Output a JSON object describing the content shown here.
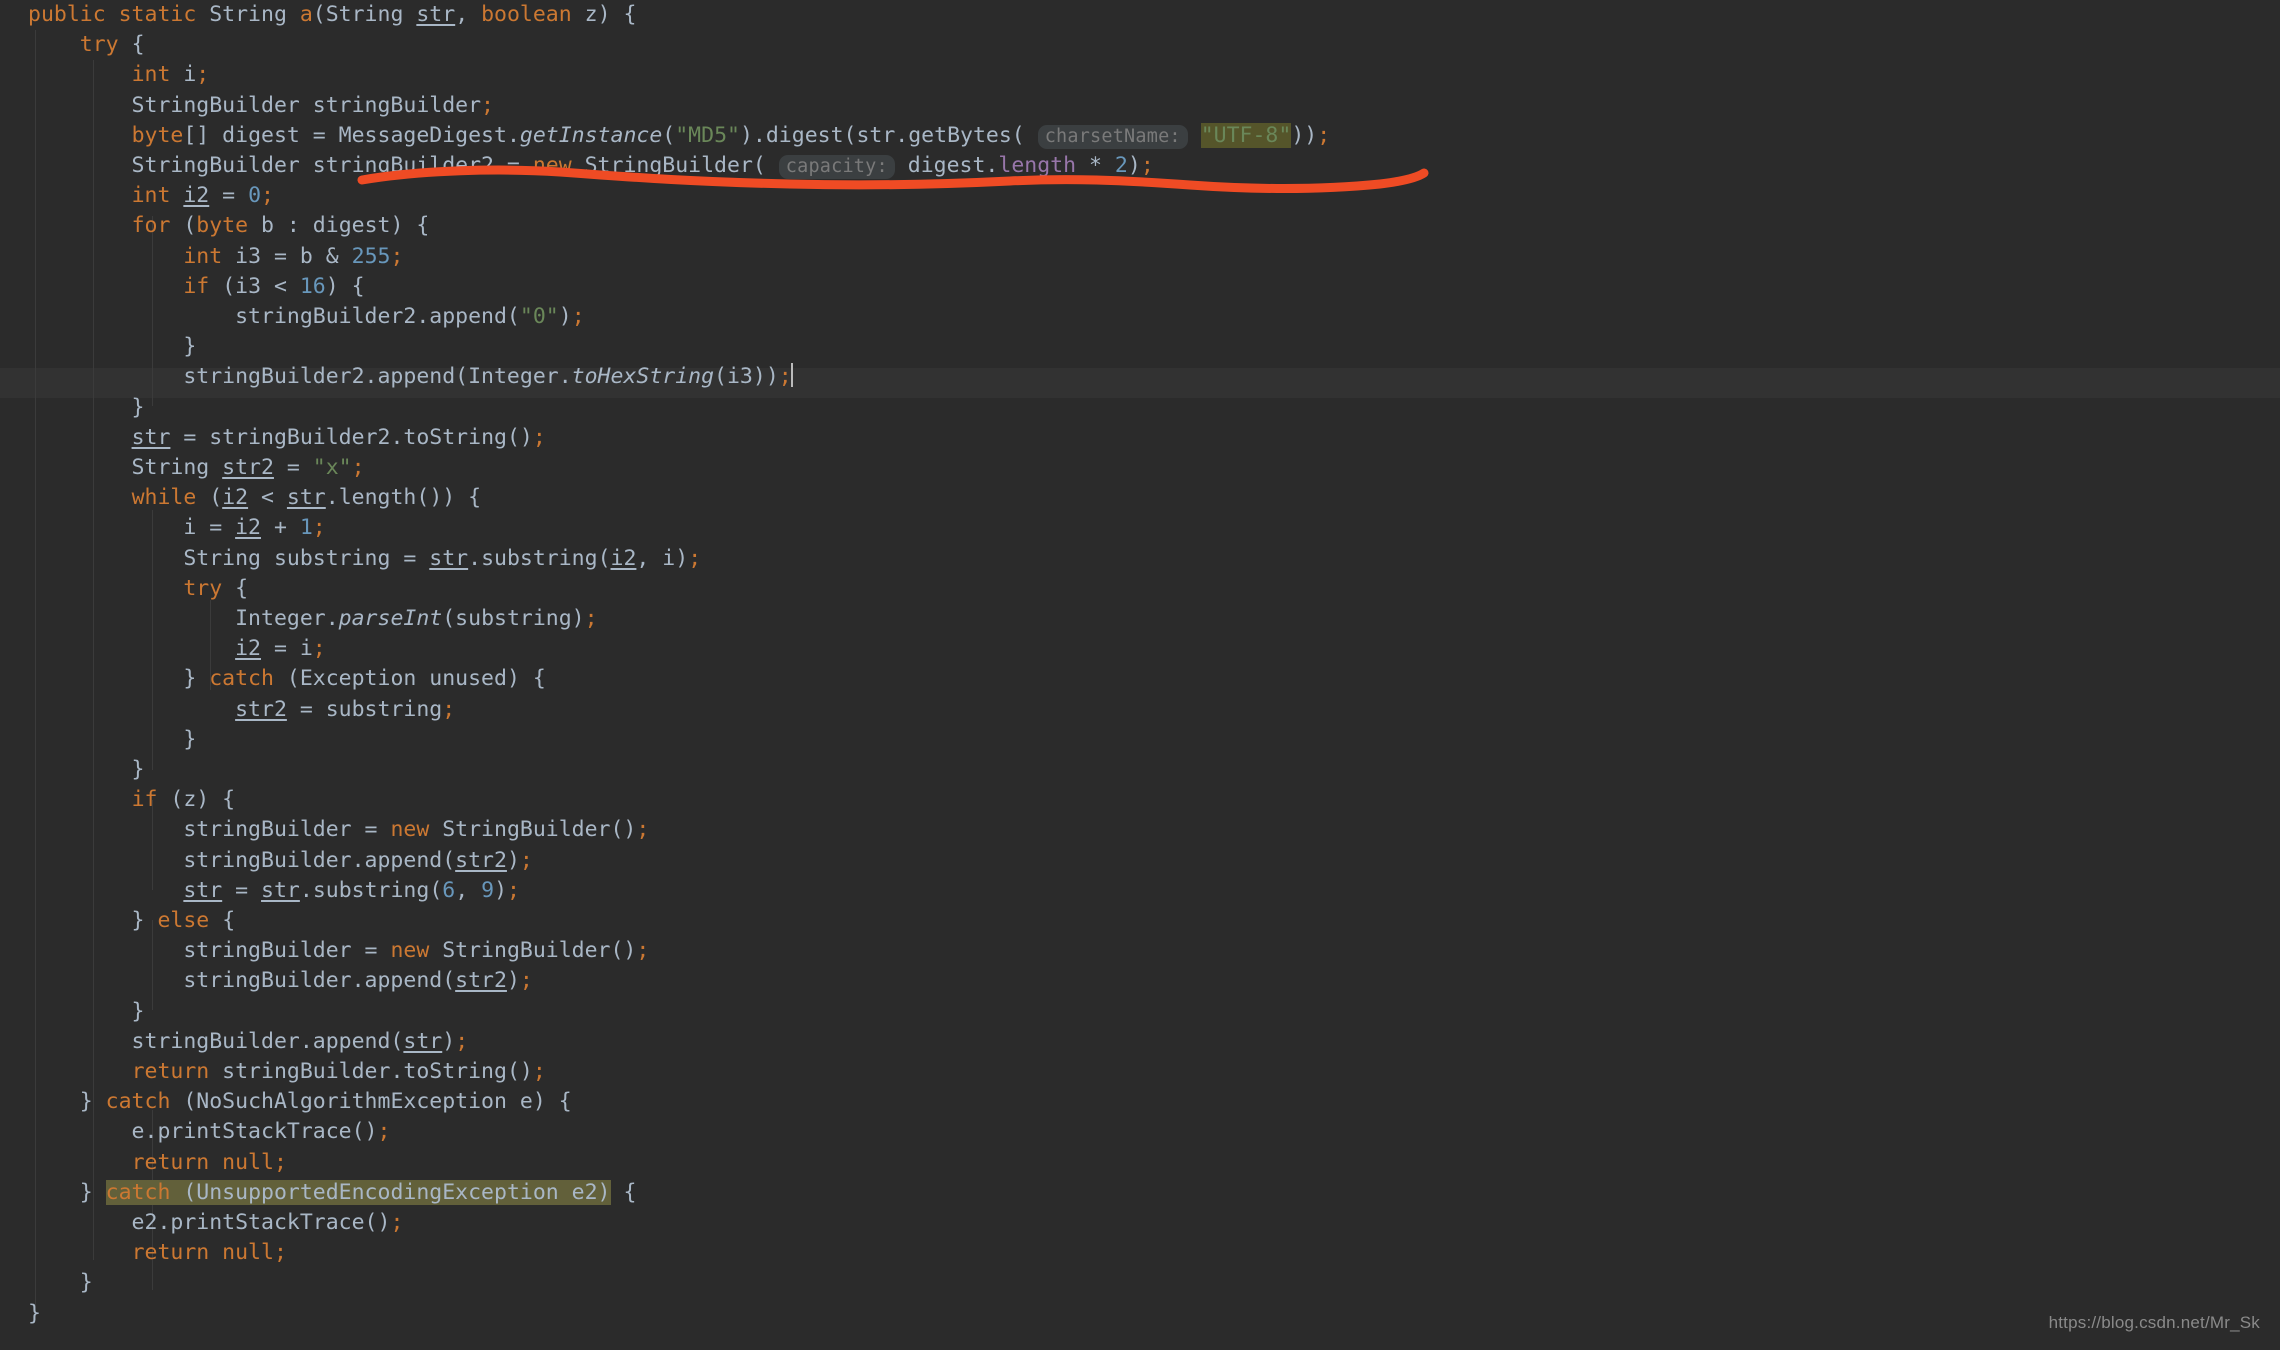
{
  "editor": {
    "language": "Java",
    "theme": "Darcula",
    "background_color": "#2b2b2b",
    "current_line_background": "#323232",
    "foreground_color": "#a9b7c6",
    "keyword_color": "#cc7832",
    "string_color": "#6a8759",
    "number_color": "#6897bb",
    "field_color": "#9876aa",
    "inlay_hint_color": "#7a7a7a",
    "usage_highlight_color": "#55552a",
    "font_size_px": 21.5,
    "line_height_px": 30.2,
    "current_line_number": 12,
    "caret_line_text": "stringBuilder2.append(Integer.toHexString(i3));"
  },
  "annotation": {
    "type": "freehand-stroke",
    "color": "#ef4b24",
    "target_line": "StringBuilder stringBuilder2 = new StringBuilder( capacity: digest.length * 2);"
  },
  "watermark": {
    "text": "https://blog.csdn.net/Mr_Sk"
  },
  "inlay_hints": [
    {
      "label": "charsetName:"
    },
    {
      "label": "capacity:"
    }
  ],
  "highlighted_tokens": [
    {
      "text": "\"UTF-8\"",
      "background": "#55552a"
    },
    {
      "text": "catch (UnsupportedEncodingException e2)",
      "background": "#62603a"
    }
  ],
  "code": {
    "lines": [
      "public static String a(String str, boolean z) {",
      "    try {",
      "        int i;",
      "        StringBuilder stringBuilder;",
      "        byte[] digest = MessageDigest.getInstance(\"MD5\").digest(str.getBytes( charsetName: \"UTF-8\"));",
      "        StringBuilder stringBuilder2 = new StringBuilder( capacity: digest.length * 2);",
      "        int i2 = 0;",
      "        for (byte b : digest) {",
      "            int i3 = b & 255;",
      "            if (i3 < 16) {",
      "                stringBuilder2.append(\"0\");",
      "            }",
      "            stringBuilder2.append(Integer.toHexString(i3));",
      "        }",
      "        str = stringBuilder2.toString();",
      "        String str2 = \"x\";",
      "        while (i2 < str.length()) {",
      "            i = i2 + 1;",
      "            String substring = str.substring(i2, i);",
      "            try {",
      "                Integer.parseInt(substring);",
      "                i2 = i;",
      "            } catch (Exception unused) {",
      "                str2 = substring;",
      "            }",
      "        }",
      "        if (z) {",
      "            stringBuilder = new StringBuilder();",
      "            stringBuilder.append(str2);",
      "            str = str.substring(6, 9);",
      "        } else {",
      "            stringBuilder = new StringBuilder();",
      "            stringBuilder.append(str2);",
      "        }",
      "        stringBuilder.append(str);",
      "        return stringBuilder.toString();",
      "    } catch (NoSuchAlgorithmException e) {",
      "        e.printStackTrace();",
      "        return null;",
      "    } catch (UnsupportedEncodingException e2) {",
      "        e2.printStackTrace();",
      "        return null;",
      "    }",
      "}"
    ]
  }
}
